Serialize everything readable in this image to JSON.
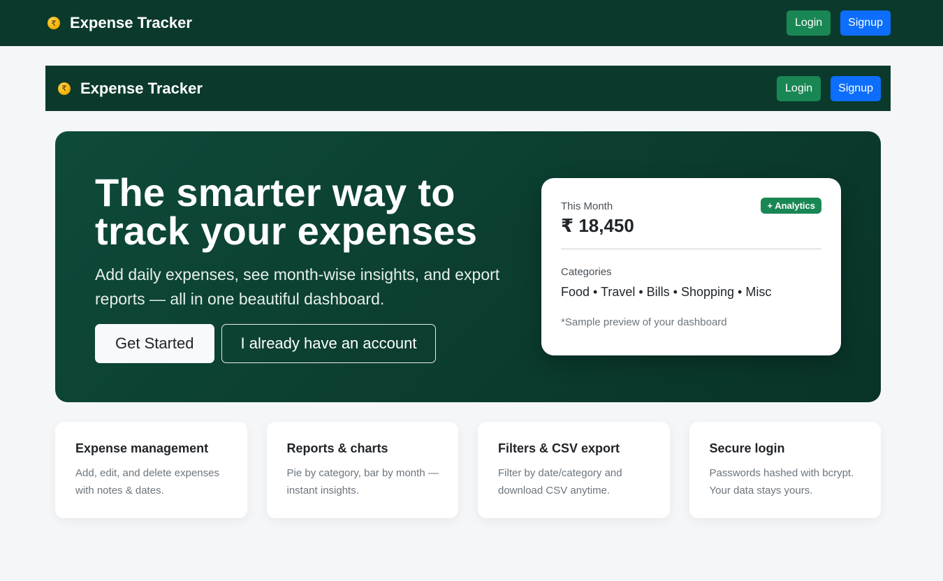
{
  "app": {
    "brand": "Expense Tracker",
    "brand_icon": "rupee-coin-icon",
    "login_label": "Login",
    "signup_label": "Signup"
  },
  "hero": {
    "title": "The smarter way to track your expenses",
    "subtitle": "Add daily expenses, see month-wise insights, and export reports — all in one beautiful dashboard.",
    "primary_cta": "Get Started",
    "secondary_cta": "I already have an account"
  },
  "preview": {
    "period_label": "This Month",
    "badge": "+ Analytics",
    "amount": "₹ 18,450",
    "categories_label": "Categories",
    "categories": "Food • Travel • Bills • Shopping • Misc",
    "note": "*Sample preview of your dashboard"
  },
  "features": [
    {
      "title": "Expense management",
      "desc": "Add, edit, and delete expenses with notes & dates."
    },
    {
      "title": "Reports & charts",
      "desc": "Pie by category, bar by month — instant insights."
    },
    {
      "title": "Filters & CSV export",
      "desc": "Filter by date/category and download CSV anytime."
    },
    {
      "title": "Secure login",
      "desc": "Passwords hashed with bcrypt. Your data stays yours."
    }
  ],
  "colors": {
    "nav_bg": "#0b3a2c",
    "hero_bg": "#0e4a3a",
    "login_green": "#198754",
    "signup_blue": "#0d6efd",
    "page_bg": "#f4f6f8"
  }
}
